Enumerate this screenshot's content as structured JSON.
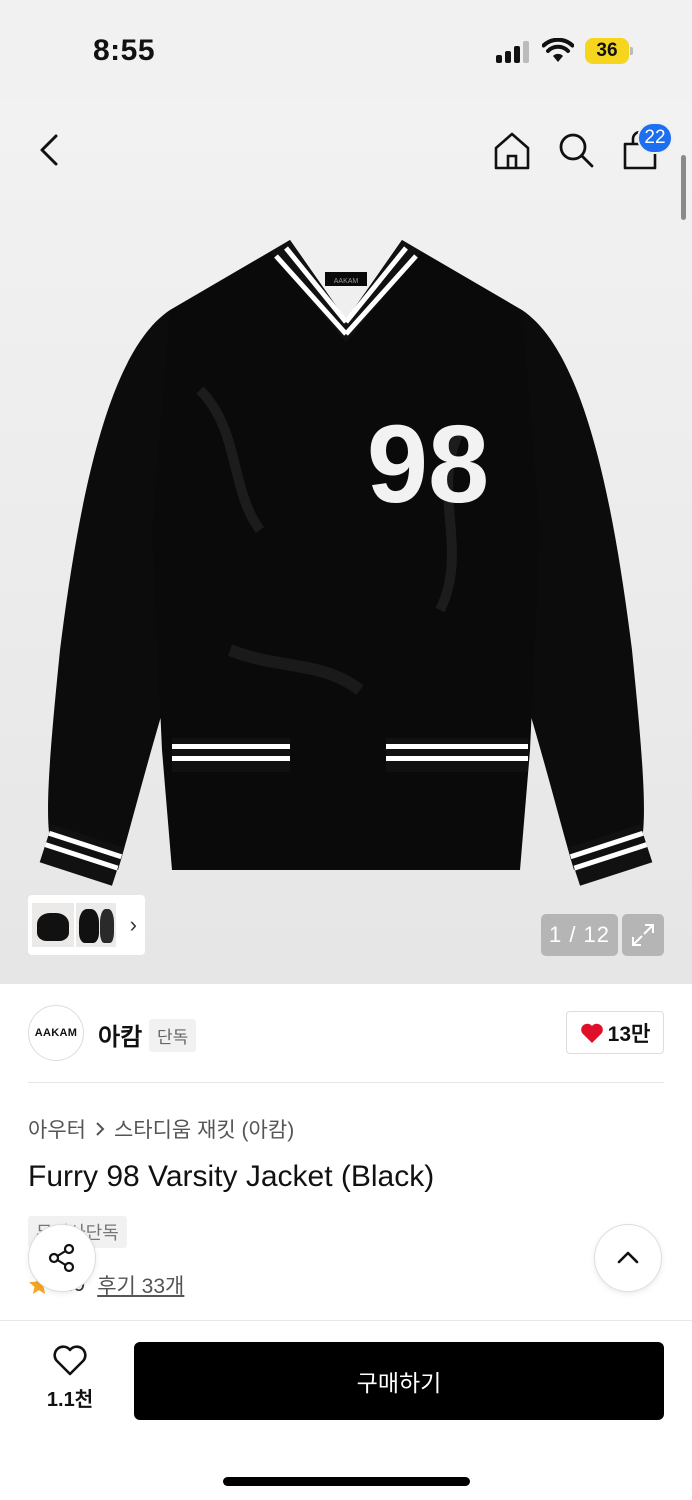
{
  "status_bar": {
    "time": "8:55",
    "battery": "36",
    "icons": [
      "signal-icon",
      "wifi-icon",
      "battery-icon"
    ]
  },
  "top_nav": {
    "icons": [
      "back-arrow-icon",
      "home-icon",
      "search-icon",
      "shopping-bag-icon"
    ],
    "cart_count": "22"
  },
  "gallery": {
    "patch_text": "98",
    "neck_label": "AAKAM",
    "pager": "1 / 12",
    "thumbs_arrow": "›"
  },
  "brand": {
    "logo_text": "AAKAM",
    "name": "아캄",
    "tag": "단독",
    "likes": "13만"
  },
  "product": {
    "breadcrumb": [
      "아우터",
      "스타디움 재킷 (아캄)"
    ],
    "title": "Furry 98 Varsity Jacket (Black)",
    "exclusive_tag": "무신사단독",
    "rating": "4.9",
    "reviews": "후기 33개"
  },
  "bottom_bar": {
    "wish_count": "1.1천",
    "buy_label": "구매하기"
  },
  "colors": {
    "accent_badge": "#1b6ff0",
    "heart": "#e0102a",
    "star": "#f5a623",
    "buy_button": "#000000"
  }
}
